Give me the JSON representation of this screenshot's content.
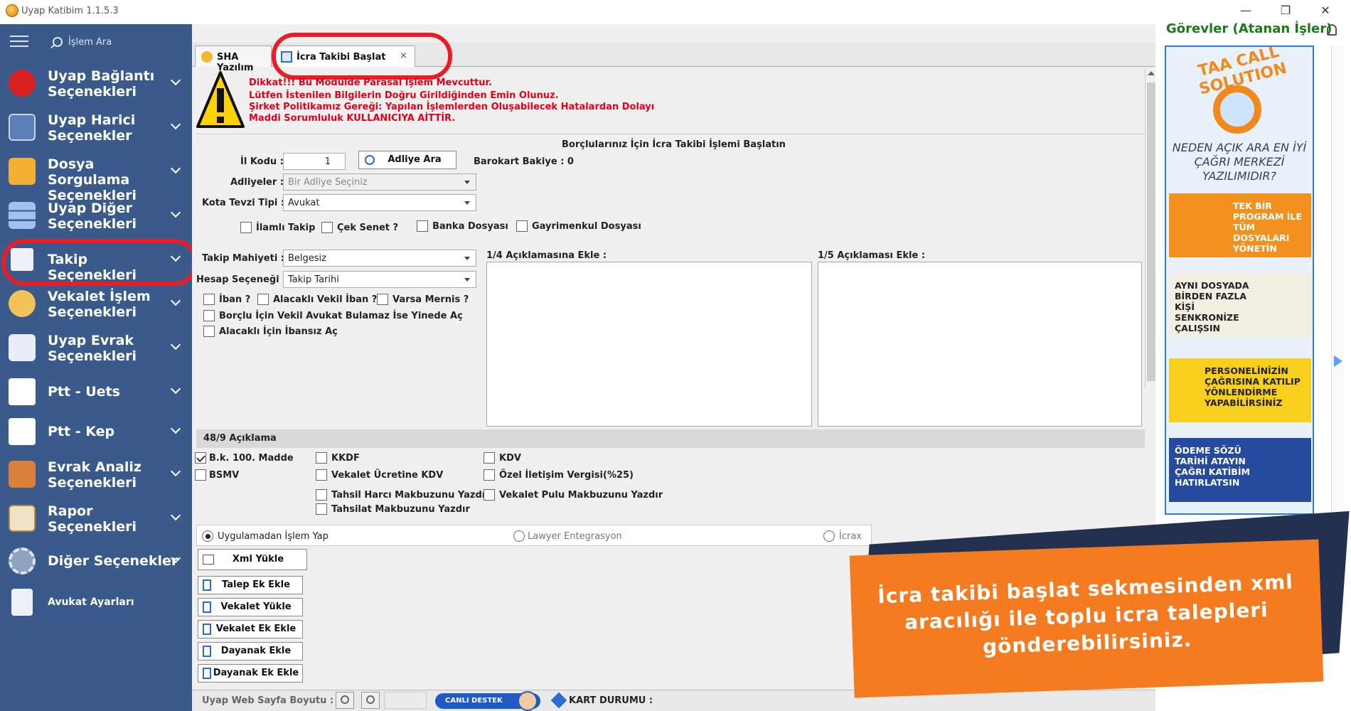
{
  "app": {
    "title": "Uyap Katibim 1.1.5.3"
  },
  "window_controls": {
    "minimize": "—",
    "maximize": "❐",
    "close": "✕"
  },
  "sidebar": {
    "search_label": "İşlem Ara",
    "items": [
      {
        "label": "Uyap Bağlantı Seçenekleri",
        "icon": "uyap-logo-icon"
      },
      {
        "label": "Uyap Harici Seçenekler",
        "icon": "help-book-icon"
      },
      {
        "label": "Dosya Sorgulama Seçenekleri",
        "icon": "folder-icon"
      },
      {
        "label": "Uyap Diğer Seçenekleri",
        "icon": "grid-icon"
      },
      {
        "label": "Takip Seçenekleri",
        "icon": "frame-icon"
      },
      {
        "label": "Vekalet İşlem Seçenekleri",
        "icon": "person-icon"
      },
      {
        "label": "Uyap Evrak Seçenekleri",
        "icon": "document-icon"
      },
      {
        "label": "Ptt - Uets",
        "icon": "ptt-icon"
      },
      {
        "label": "Ptt - Kep",
        "icon": "ptt-icon"
      },
      {
        "label": "Evrak Analiz Seçenekleri",
        "icon": "briefcase-icon"
      },
      {
        "label": "Rapor Seçenekleri",
        "icon": "clipboard-icon"
      },
      {
        "label": "Diğer Seçenekler",
        "icon": "gear-icon"
      },
      {
        "label": "Avukat Ayarları",
        "icon": "lawyer-icon"
      }
    ]
  },
  "tabs": [
    {
      "label": "SHA Yazılım",
      "active": false
    },
    {
      "label": "İcra Takibi Başlat",
      "active": true,
      "close": "×"
    }
  ],
  "warning": {
    "lines": [
      "Dikkat!!! Bu Modülde Parasal İşlem Mevcuttur.",
      "Lütfen İstenilen Bilgilerin Doğru Girildiğinden Emin Olunuz.",
      "Şirket Politikamız Gereği: Yapılan İşlemlerden Oluşabilecek Hatalardan Dolayı",
      "Maddi Sorumluluk KULLANICIYA AİTTİR."
    ]
  },
  "form": {
    "heading": "Borçlularınız İçin İcra Takibi İşlemi Başlatın",
    "il_kodu_label": "İl Kodu :",
    "il_kodu_value": "1",
    "adliye_ara_button": "Adliye Ara",
    "barokart_label": "Barokart Bakiye : 0",
    "adliyeler_label": "Adliyeler :",
    "adliyeler_placeholder": "Bir Adliye Seçiniz",
    "kota_label": "Kota Tevzi Tipi :",
    "kota_value": "Avukat",
    "checks_row1": [
      {
        "label": "İlamlı Takip",
        "checked": false
      },
      {
        "label": "Çek Senet ?",
        "checked": false
      },
      {
        "label": "Banka Dosyası",
        "checked": false
      },
      {
        "label": "Gayrimenkul Dosyası",
        "checked": false
      }
    ],
    "takip_mahiyeti_label": "Takip Mahiyeti :",
    "takip_mahiyeti_value": "Belgesiz",
    "hesap_label": "Hesap Seçeneği :",
    "hesap_value": "Takip Tarihi",
    "aciklama_14_label": "1/4 Açıklamasına Ekle :",
    "aciklama_15_label": "1/5 Açıklaması Ekle :",
    "checks_row2": [
      {
        "label": "İban ?",
        "checked": false
      },
      {
        "label": "Alacaklı Vekil İban ?",
        "checked": false
      },
      {
        "label": "Varsa Mernis ?",
        "checked": false
      }
    ],
    "check_borclu": "Borçlu İçin Vekil Avukat Bulamaz İse Yinede Aç",
    "check_ibansiz": "Alacaklı İçin İbansız Aç"
  },
  "section_489": {
    "title": "48/9 Açıklama",
    "checks": [
      {
        "label": "B.k. 100. Madde",
        "checked": true
      },
      {
        "label": "KKDF",
        "checked": false
      },
      {
        "label": "KDV",
        "checked": false
      },
      {
        "label": "BSMV",
        "checked": false
      },
      {
        "label": "Vekalet Ücretine KDV",
        "checked": false
      },
      {
        "label": "Özel İletişim Vergisi(%25)",
        "checked": false
      },
      {
        "label": "Tahsil Harcı Makbuzunu Yazdır",
        "checked": false
      },
      {
        "label": "Vekalet Pulu Makbuzunu Yazdır",
        "checked": false
      },
      {
        "label": "Tahsilat Makbuzunu Yazdır",
        "checked": false
      }
    ]
  },
  "radios": [
    {
      "label": "Uygulamadan İşlem Yap",
      "on": true
    },
    {
      "label": "Lawyer Entegrasyon",
      "on": false
    },
    {
      "label": "İcrax",
      "on": false
    }
  ],
  "action_buttons": {
    "xml": "Xml Yükle",
    "talep": "Talep Ek Ekle",
    "vekalet_yukle": "Vekalet Yükle",
    "vekalet_ek": "Vekalet Ek Ekle",
    "dayanak": "Dayanak Ekle",
    "dayanak_ek": "Dayanak Ek Ekle"
  },
  "right_pane": {
    "tasks_title": "Görevler (Atanan İşler)",
    "ad_brand": "TAA CALL SOLUTION",
    "ad_question": "NEDEN AÇIK ARA EN İYİ ÇAĞRI MERKEZİ YAZILIMIDIR?",
    "ad_cards": [
      "TEK BİR PROGRAM İLE TÜM DOSYALARI YÖNETİN",
      "AYNI DOSYADA BİRDEN FAZLA KİŞİ SENKRONİZE ÇALIŞSIN",
      "PERSONELİNİZİN ÇAĞRISINA KATILIP YÖNLENDİRME YAPABİLİRSİNİZ",
      "ÖDEME SÖZÜ TARİHİ ATAYIN ÇAĞRI KATİBİM HATIRLATSIN"
    ]
  },
  "overlay": {
    "text": "İcra takibi başlat sekmesinden xml aracılığı ile toplu icra talepleri gönderebilirsiniz."
  },
  "status_bar": {
    "page_size_label": "Uyap Web Sayfa Boyutu :",
    "live_support": "CANLI DESTEK",
    "kart_durumu": "KART DURUMU :"
  },
  "colors": {
    "sidebar": "#3a5a8c",
    "highlight_ring": "#e81d25",
    "overlay_orange": "#f47b20",
    "overlay_dark": "#233050",
    "warning_text": "#e2001a",
    "tasks_title": "#1a7a1a"
  }
}
